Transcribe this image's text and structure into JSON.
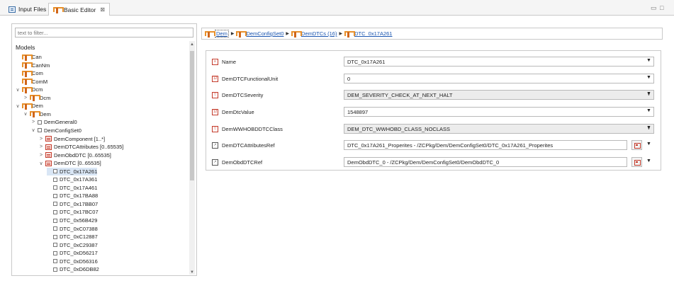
{
  "tabs": [
    {
      "label": "Input Files",
      "active": false
    },
    {
      "label": "Basic Editor",
      "active": true,
      "close": "⊠"
    }
  ],
  "window_controls": {
    "minimize": "▭",
    "maximize": "□"
  },
  "left": {
    "filter_placeholder": "text to filter...",
    "models_label": "Models",
    "tree": [
      {
        "label": "Can",
        "depth": 0,
        "icon": "module",
        "arrow": ""
      },
      {
        "label": "CanNm",
        "depth": 0,
        "icon": "module",
        "arrow": ""
      },
      {
        "label": "Com",
        "depth": 0,
        "icon": "module",
        "arrow": ""
      },
      {
        "label": "ComM",
        "depth": 0,
        "icon": "module",
        "arrow": ""
      },
      {
        "label": "Dcm",
        "depth": 0,
        "icon": "module",
        "arrow": "∨"
      },
      {
        "label": "Dcm",
        "depth": 1,
        "icon": "module",
        "arrow": ">"
      },
      {
        "label": "Dem",
        "depth": 0,
        "icon": "module",
        "arrow": "∨"
      },
      {
        "label": "Dem",
        "depth": 1,
        "icon": "module",
        "arrow": "∨"
      },
      {
        "label": "DemGeneral0",
        "depth": 2,
        "icon": "box",
        "arrow": ">"
      },
      {
        "label": "DemConfigSet0",
        "depth": 2,
        "icon": "box",
        "arrow": "∨"
      },
      {
        "label": "DemComponent [1..*]",
        "depth": 3,
        "icon": "container",
        "arrow": ">"
      },
      {
        "label": "DemDTCAttributes [0..65535]",
        "depth": 3,
        "icon": "container",
        "arrow": ">"
      },
      {
        "label": "DemObdDTC [0..65535]",
        "depth": 3,
        "icon": "container",
        "arrow": ">"
      },
      {
        "label": "DemDTC [0..65535]",
        "depth": 3,
        "icon": "container",
        "arrow": "∨"
      },
      {
        "label": "DTC_0x17A261",
        "depth": 4,
        "icon": "box",
        "arrow": "",
        "selected": true
      },
      {
        "label": "DTC_0x17A361",
        "depth": 4,
        "icon": "box",
        "arrow": ""
      },
      {
        "label": "DTC_0x17A461",
        "depth": 4,
        "icon": "box",
        "arrow": ""
      },
      {
        "label": "DTC_0x17BA88",
        "depth": 4,
        "icon": "box",
        "arrow": ""
      },
      {
        "label": "DTC_0x17BB07",
        "depth": 4,
        "icon": "box",
        "arrow": ""
      },
      {
        "label": "DTC_0x17BC07",
        "depth": 4,
        "icon": "box",
        "arrow": ""
      },
      {
        "label": "DTC_0x56B429",
        "depth": 4,
        "icon": "box",
        "arrow": ""
      },
      {
        "label": "DTC_0xC07388",
        "depth": 4,
        "icon": "box",
        "arrow": ""
      },
      {
        "label": "DTC_0xC12887",
        "depth": 4,
        "icon": "box",
        "arrow": ""
      },
      {
        "label": "DTC_0xC29387",
        "depth": 4,
        "icon": "box",
        "arrow": ""
      },
      {
        "label": "DTC_0xD56217",
        "depth": 4,
        "icon": "box",
        "arrow": ""
      },
      {
        "label": "DTC_0xD56316",
        "depth": 4,
        "icon": "box",
        "arrow": ""
      },
      {
        "label": "DTC_0xD6DB82",
        "depth": 4,
        "icon": "box",
        "arrow": ""
      }
    ]
  },
  "breadcrumb": [
    {
      "label": "Dem",
      "link": true
    },
    {
      "label": "DemConfigSet0",
      "link": true
    },
    {
      "label": "DemDTCs (16)",
      "link": true
    },
    {
      "label": "DTC_0x17A261",
      "link": true
    }
  ],
  "form": [
    {
      "label": "Name",
      "value": "DTC_0x17A261",
      "kind": "text",
      "icon": "name"
    },
    {
      "label": "DemDTCFunctionalUnit",
      "value": "0",
      "kind": "text",
      "icon": "num"
    },
    {
      "label": "DemDTCSeverity",
      "value": "DEM_SEVERITY_CHECK_AT_NEXT_HALT",
      "kind": "combo",
      "icon": "enum"
    },
    {
      "label": "DemDtcValue",
      "value": "1548897",
      "kind": "text",
      "icon": "num"
    },
    {
      "label": "DemWWHOBDDTCClass",
      "value": "DEM_DTC_WWHOBD_CLASS_NOCLASS",
      "kind": "combo",
      "icon": "enum"
    },
    {
      "label": "DemDTCAttributesRef",
      "value": "DTC_0x17A261_Properites - /ZCPkg/Dem/DemConfigSet0/DTC_0x17A261_Properites",
      "kind": "ref",
      "icon": "ref"
    },
    {
      "label": "DemObdDTCRef",
      "value": "DemObdDTC_0 - /ZCPkg/Dem/DemConfigSet0/DemObdDTC_0",
      "kind": "ref",
      "icon": "ref"
    }
  ]
}
